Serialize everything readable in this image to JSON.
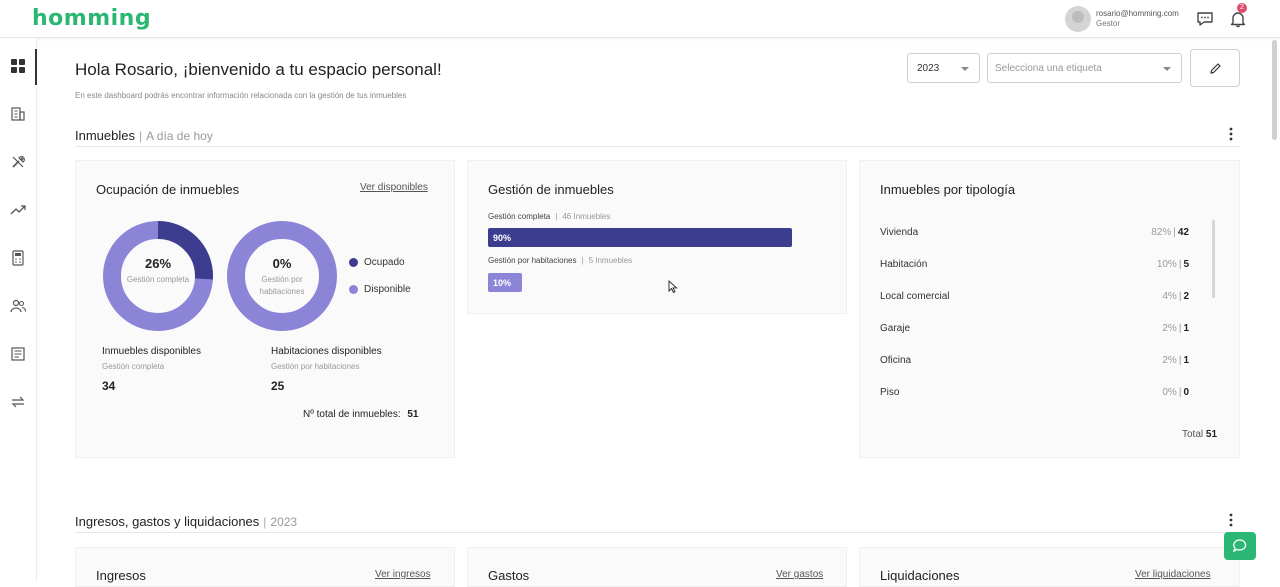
{
  "brand": {
    "logo_text": "homming",
    "color": "#2bb673"
  },
  "header": {
    "user_email": "rosario@homming.com",
    "user_role": "Gestor",
    "notification_count": "2"
  },
  "sidebar": {
    "items": [
      {
        "icon": "dashboard-icon",
        "active": true
      },
      {
        "icon": "building-icon"
      },
      {
        "icon": "tools-icon"
      },
      {
        "icon": "trending-icon"
      },
      {
        "icon": "calculator-icon"
      },
      {
        "icon": "users-icon"
      },
      {
        "icon": "document-icon"
      },
      {
        "icon": "transfer-icon"
      }
    ]
  },
  "page": {
    "title": "Hola Rosario, ¡bienvenido a tu espacio personal!",
    "subtitle": "En este dashboard podrás encontrar información relacionada con la gestión de tus inmuebles",
    "year_value": "2023",
    "tag_placeholder": "Selecciona una etiqueta"
  },
  "section_inmuebles": {
    "title": "Inmuebles",
    "extra": "A día de hoy"
  },
  "ocupacion": {
    "title": "Ocupación de inmuebles",
    "link": "Ver disponibles",
    "donut1_pct": "26%",
    "donut1_label": "Gestión completa",
    "donut1_fraction": 0.26,
    "donut2_pct": "0%",
    "donut2_label": "Gestión por habitaciones",
    "donut2_fraction": 0.0,
    "legend_ocupado": "Ocupado",
    "legend_disponible": "Disponible",
    "color_ocupado": "#3d3d8f",
    "color_disponible": "#8b84d7",
    "stat1_title": "Inmuebles disponibles",
    "stat1_sub": "Gestión completa",
    "stat1_value": "34",
    "stat2_title": "Habitaciones disponibles",
    "stat2_sub": "Gestión por habitaciones",
    "stat2_value": "25",
    "total_label": "Nº total de inmuebles:",
    "total_value": "51"
  },
  "gestion": {
    "title": "Gestión de inmuebles",
    "row1_label": "Gestión completa",
    "row1_count": "46 Inmuebles",
    "row1_pct": "90%",
    "row1_fraction": 0.9,
    "row2_label": "Gestión por habitaciones",
    "row2_count": "5 Inmuebles",
    "row2_pct": "10%",
    "row2_fraction": 0.1
  },
  "tipologia": {
    "title": "Inmuebles por tipología",
    "rows": [
      {
        "name": "Vivienda",
        "pct": "82%",
        "count": "42"
      },
      {
        "name": "Habitación",
        "pct": "10%",
        "count": "5"
      },
      {
        "name": "Local comercial",
        "pct": "4%",
        "count": "2"
      },
      {
        "name": "Garaje",
        "pct": "2%",
        "count": "1"
      },
      {
        "name": "Oficina",
        "pct": "2%",
        "count": "1"
      },
      {
        "name": "Piso",
        "pct": "0%",
        "count": "0"
      }
    ],
    "total_label": "Total",
    "total_value": "51"
  },
  "section_ingresos": {
    "title": "Ingresos, gastos y liquidaciones",
    "extra": "2023"
  },
  "bottom_cards": {
    "ingresos_title": "Ingresos",
    "ingresos_link": "Ver ingresos",
    "gastos_title": "Gastos",
    "gastos_link": "Ver gastos",
    "liquidaciones_title": "Liquidaciones",
    "liquidaciones_link": "Ver liquidaciones"
  }
}
